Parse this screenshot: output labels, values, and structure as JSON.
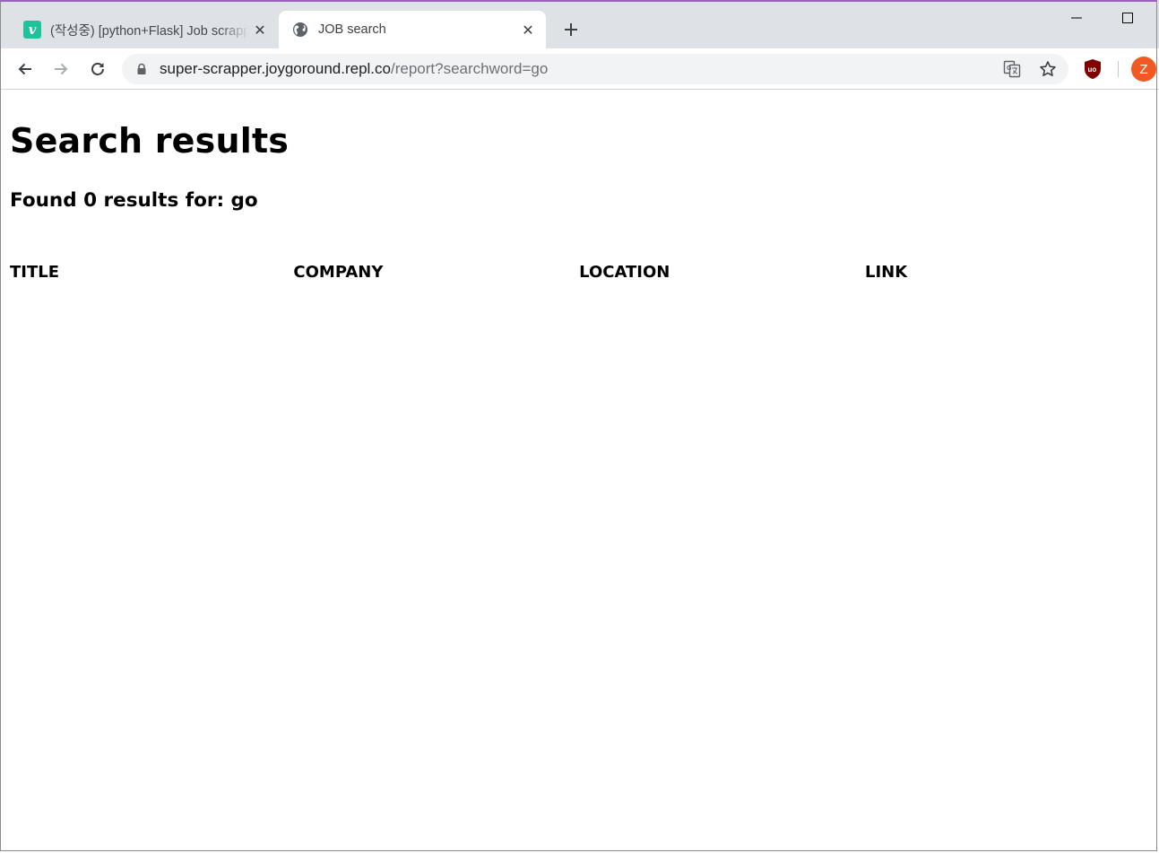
{
  "browser": {
    "tabs": [
      {
        "title": "(작성중) [python+Flask] Job scrapper",
        "favicon": "vimeo-v-icon",
        "active": false
      },
      {
        "title": "JOB search",
        "favicon": "globe-icon",
        "active": true
      }
    ],
    "favicon_letter": "v",
    "close_glyph": "✕",
    "url_host": "super-scrapper.joygoround.repl.co",
    "url_path": "/report?searchword=go",
    "profile_initial": "Z",
    "colors": {
      "tabstrip": "#dee1e6",
      "omnibox": "#f1f3f4",
      "avatar": "#f05a22",
      "ublock": "#800000"
    }
  },
  "page": {
    "heading": "Search results",
    "summary": "Found 0 results for: go",
    "table": {
      "columns": [
        "TITLE",
        "COMPANY",
        "LOCATION",
        "LINK"
      ],
      "rows": []
    }
  }
}
